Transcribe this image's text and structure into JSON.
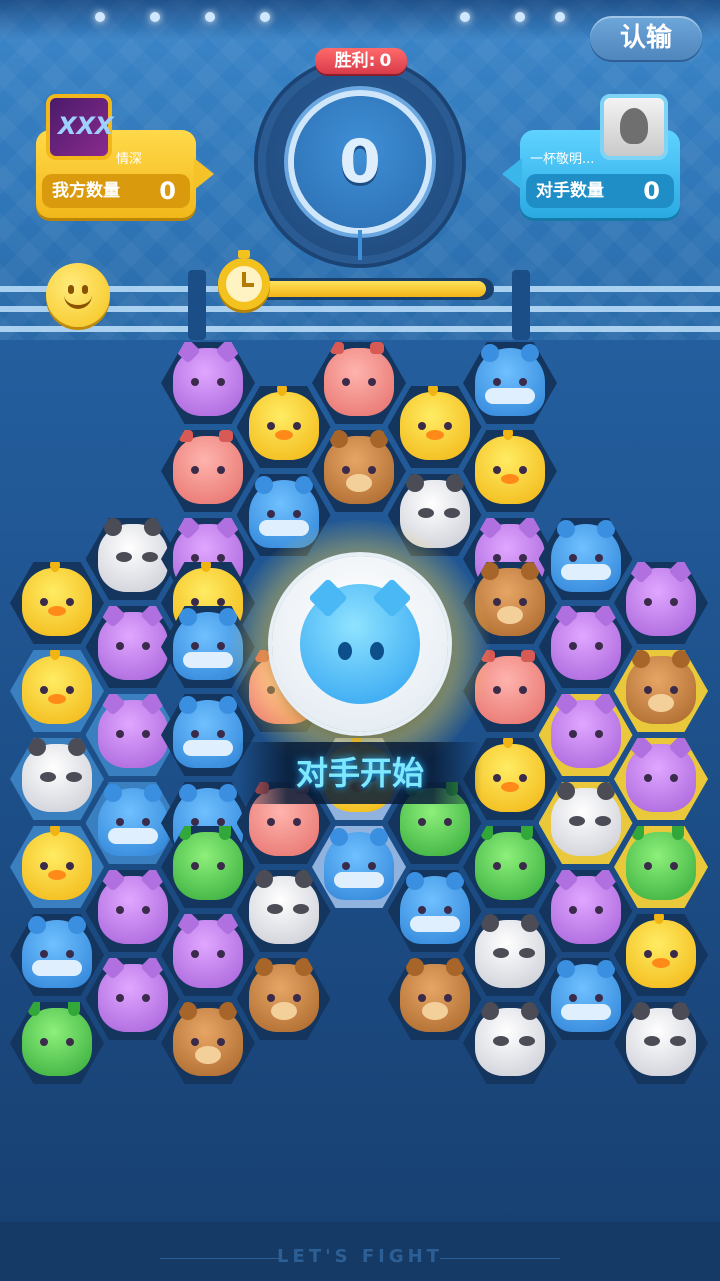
{
  "header": {
    "surrender_label": "认输",
    "win_label": "胜利:",
    "win_value": "0",
    "score": "0"
  },
  "player_left": {
    "name": "情深",
    "count_label": "我方数量",
    "count": "0",
    "avatar_text": "XXX"
  },
  "player_right": {
    "name": "一杯敬明...",
    "count_label": "对手数量",
    "count": "0"
  },
  "timer": {
    "remaining_fraction": 0.98
  },
  "overlay": {
    "banner": "对手开始"
  },
  "footer": {
    "text": "LET'S FIGHT"
  },
  "board": {
    "pieces": [
      {
        "col": 2,
        "row": 0,
        "t": "cat"
      },
      {
        "col": 4,
        "row": 0,
        "t": "deer"
      },
      {
        "col": 6,
        "row": 0,
        "t": "fish"
      },
      {
        "col": 3,
        "row": 1,
        "t": "chick"
      },
      {
        "col": 5,
        "row": 1,
        "t": "chick"
      },
      {
        "col": 2,
        "row": 2,
        "t": "deer"
      },
      {
        "col": 4,
        "row": 2,
        "t": "bear"
      },
      {
        "col": 6,
        "row": 2,
        "t": "chick"
      },
      {
        "col": 3,
        "row": 3,
        "t": "fish"
      },
      {
        "col": 5,
        "row": 3,
        "t": "panda"
      },
      {
        "col": 1,
        "row": 4,
        "t": "panda"
      },
      {
        "col": 2,
        "row": 4,
        "t": "cat"
      },
      {
        "col": 6,
        "row": 4,
        "t": "cat"
      },
      {
        "col": 7,
        "row": 4,
        "t": "fish"
      },
      {
        "col": 0,
        "row": 5,
        "t": "chick"
      },
      {
        "col": 2,
        "row": 5,
        "t": "chick"
      },
      {
        "col": 6,
        "row": 5,
        "t": "bear"
      },
      {
        "col": 8,
        "row": 5,
        "t": "cat"
      },
      {
        "col": 1,
        "row": 6,
        "t": "cat"
      },
      {
        "col": 2,
        "row": 6,
        "t": "fish"
      },
      {
        "col": 7,
        "row": 6,
        "t": "cat"
      },
      {
        "col": 0,
        "row": 7,
        "t": "chick",
        "h": "blue"
      },
      {
        "col": 3,
        "row": 7,
        "t": "deer"
      },
      {
        "col": 6,
        "row": 7,
        "t": "deer"
      },
      {
        "col": 8,
        "row": 7,
        "t": "bear",
        "h": "yellow"
      },
      {
        "col": 1,
        "row": 8,
        "t": "cat",
        "h": "blue"
      },
      {
        "col": 2,
        "row": 8,
        "t": "fish"
      },
      {
        "col": 7,
        "row": 8,
        "t": "cat",
        "h": "yellow"
      },
      {
        "col": 0,
        "row": 9,
        "t": "panda",
        "h": "blue"
      },
      {
        "col": 4,
        "row": 9,
        "t": "chick",
        "h": "white"
      },
      {
        "col": 6,
        "row": 9,
        "t": "chick"
      },
      {
        "col": 8,
        "row": 9,
        "t": "cat",
        "h": "yellow"
      },
      {
        "col": 1,
        "row": 10,
        "t": "fish",
        "h": "blue"
      },
      {
        "col": 2,
        "row": 10,
        "t": "fish"
      },
      {
        "col": 3,
        "row": 10,
        "t": "deer"
      },
      {
        "col": 5,
        "row": 10,
        "t": "frog"
      },
      {
        "col": 7,
        "row": 10,
        "t": "panda",
        "h": "yellow"
      },
      {
        "col": 0,
        "row": 11,
        "t": "chick",
        "h": "blue"
      },
      {
        "col": 2,
        "row": 11,
        "t": "frog"
      },
      {
        "col": 4,
        "row": 11,
        "t": "fish",
        "h": "white"
      },
      {
        "col": 6,
        "row": 11,
        "t": "frog"
      },
      {
        "col": 8,
        "row": 11,
        "t": "frog",
        "h": "yellow"
      },
      {
        "col": 1,
        "row": 12,
        "t": "cat"
      },
      {
        "col": 3,
        "row": 12,
        "t": "panda"
      },
      {
        "col": 5,
        "row": 12,
        "t": "fish"
      },
      {
        "col": 7,
        "row": 12,
        "t": "cat"
      },
      {
        "col": 0,
        "row": 13,
        "t": "fish"
      },
      {
        "col": 2,
        "row": 13,
        "t": "cat"
      },
      {
        "col": 6,
        "row": 13,
        "t": "panda"
      },
      {
        "col": 8,
        "row": 13,
        "t": "chick"
      },
      {
        "col": 1,
        "row": 14,
        "t": "cat"
      },
      {
        "col": 3,
        "row": 14,
        "t": "bear"
      },
      {
        "col": 5,
        "row": 14,
        "t": "bear"
      },
      {
        "col": 7,
        "row": 14,
        "t": "fish"
      },
      {
        "col": 0,
        "row": 15,
        "t": "frog"
      },
      {
        "col": 2,
        "row": 15,
        "t": "bear"
      },
      {
        "col": 6,
        "row": 15,
        "t": "panda"
      },
      {
        "col": 8,
        "row": 15,
        "t": "panda"
      }
    ]
  }
}
